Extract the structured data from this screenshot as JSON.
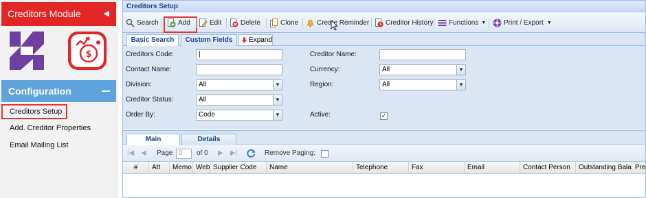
{
  "sidebar": {
    "module_title": "Creditors Module",
    "section_title": "Configuration",
    "links": [
      {
        "label": "Creditors Setup"
      },
      {
        "label": "Add. Creditor Properties"
      },
      {
        "label": "Email Mailing List"
      }
    ]
  },
  "panel": {
    "title": "Creditors Setup"
  },
  "toolbar": {
    "search": "Search",
    "add": "Add",
    "edit": "Edit",
    "delete": "Delete",
    "clone": "Clone",
    "create_reminder": "Create Reminder",
    "creditor_history": "Creditor History",
    "functions": "Functions",
    "print_export": "Print / Export"
  },
  "search_tabs": {
    "basic": "Basic Search",
    "custom": "Custom Fields",
    "expand": "Expand"
  },
  "form": {
    "creditors_code_label": "Creditors Code:",
    "creditors_code_value": "|",
    "creditor_name_label": "Creditor Name:",
    "creditor_name_value": "",
    "contact_name_label": "Contact Name:",
    "contact_name_value": "",
    "currency_label": "Currency:",
    "currency_value": "All",
    "division_label": "Division:",
    "division_value": "All",
    "region_label": "Region:",
    "region_value": "All",
    "creditor_status_label": "Creditor Status:",
    "creditor_status_value": "All",
    "order_by_label": "Order By:",
    "order_by_value": "Code",
    "active_label": "Active:",
    "active_checked": "✓"
  },
  "grid_tabs": {
    "main": "Main",
    "details": "Details"
  },
  "pager": {
    "page_label": "Page",
    "page_value": "0",
    "of_label": "of 0",
    "remove_paging_label": "Remove Paging:"
  },
  "grid": {
    "columns": [
      "#",
      "Att",
      "Memo",
      "Website",
      "Supplier Code",
      "Name",
      "Telephone",
      "Fax",
      "Email",
      "Contact Person",
      "Outstanding Balance",
      "Pref"
    ]
  },
  "colors": {
    "brand_red": "#e22626",
    "config_blue": "#5ea3dc",
    "highlight_red": "#e03535",
    "panel_border": "#99bbe8"
  }
}
